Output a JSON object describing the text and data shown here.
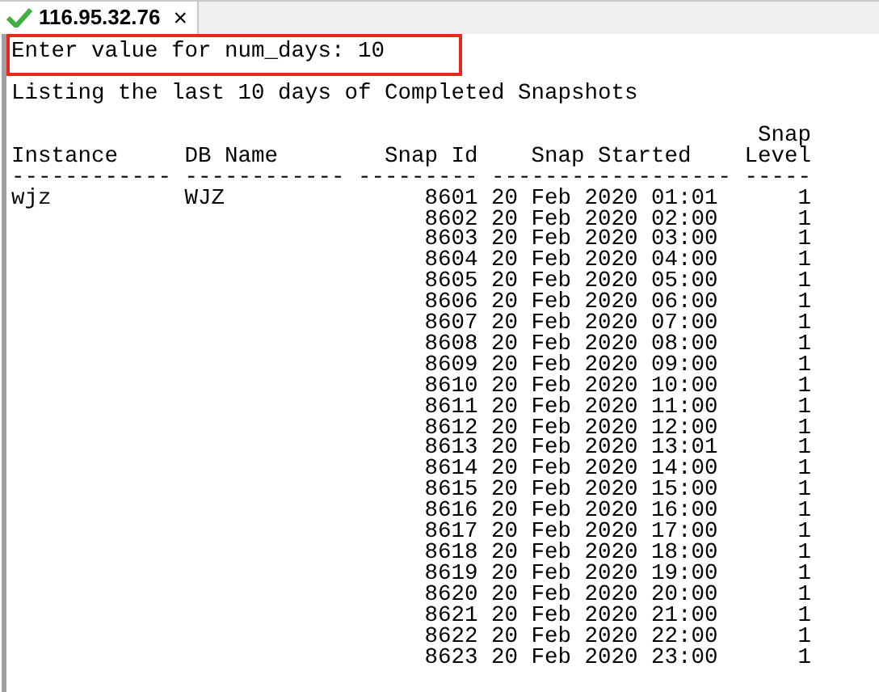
{
  "tab": {
    "title": "116.95.32.76",
    "connected": true,
    "close": "×"
  },
  "terminal": {
    "prompt": {
      "text": "Enter value for num_days: 10",
      "highlighted": true
    },
    "message": "Listing the last 10 days of Completed Snapshots",
    "columns": [
      {
        "label": "Instance",
        "rule": "------------"
      },
      {
        "label": "DB Name",
        "rule": "------------"
      },
      {
        "label": "Snap Id",
        "rule": "---------"
      },
      {
        "label": "Snap Started",
        "rule": "------------------"
      },
      {
        "label": "Snap Level",
        "rule": "-----"
      }
    ],
    "rows": [
      [
        "wjz",
        "WJZ",
        "8601",
        "20 Feb 2020 01:01",
        "1"
      ],
      [
        "",
        "",
        "8602",
        "20 Feb 2020 02:00",
        "1"
      ],
      [
        "",
        "",
        "8603",
        "20 Feb 2020 03:00",
        "1"
      ],
      [
        "",
        "",
        "8604",
        "20 Feb 2020 04:00",
        "1"
      ],
      [
        "",
        "",
        "8605",
        "20 Feb 2020 05:00",
        "1"
      ],
      [
        "",
        "",
        "8606",
        "20 Feb 2020 06:00",
        "1"
      ],
      [
        "",
        "",
        "8607",
        "20 Feb 2020 07:00",
        "1"
      ],
      [
        "",
        "",
        "8608",
        "20 Feb 2020 08:00",
        "1"
      ],
      [
        "",
        "",
        "8609",
        "20 Feb 2020 09:00",
        "1"
      ],
      [
        "",
        "",
        "8610",
        "20 Feb 2020 10:00",
        "1"
      ],
      [
        "",
        "",
        "8611",
        "20 Feb 2020 11:00",
        "1"
      ],
      [
        "",
        "",
        "8612",
        "20 Feb 2020 12:00",
        "1"
      ],
      [
        "",
        "",
        "8613",
        "20 Feb 2020 13:01",
        "1"
      ],
      [
        "",
        "",
        "8614",
        "20 Feb 2020 14:00",
        "1"
      ],
      [
        "",
        "",
        "8615",
        "20 Feb 2020 15:00",
        "1"
      ],
      [
        "",
        "",
        "8616",
        "20 Feb 2020 16:00",
        "1"
      ],
      [
        "",
        "",
        "8617",
        "20 Feb 2020 17:00",
        "1"
      ],
      [
        "",
        "",
        "8618",
        "20 Feb 2020 18:00",
        "1"
      ],
      [
        "",
        "",
        "8619",
        "20 Feb 2020 19:00",
        "1"
      ],
      [
        "",
        "",
        "8620",
        "20 Feb 2020 20:00",
        "1"
      ],
      [
        "",
        "",
        "8621",
        "20 Feb 2020 21:00",
        "1"
      ],
      [
        "",
        "",
        "8622",
        "20 Feb 2020 22:00",
        "1"
      ],
      [
        "",
        "",
        "8623",
        "20 Feb 2020 23:00",
        "1"
      ]
    ]
  }
}
